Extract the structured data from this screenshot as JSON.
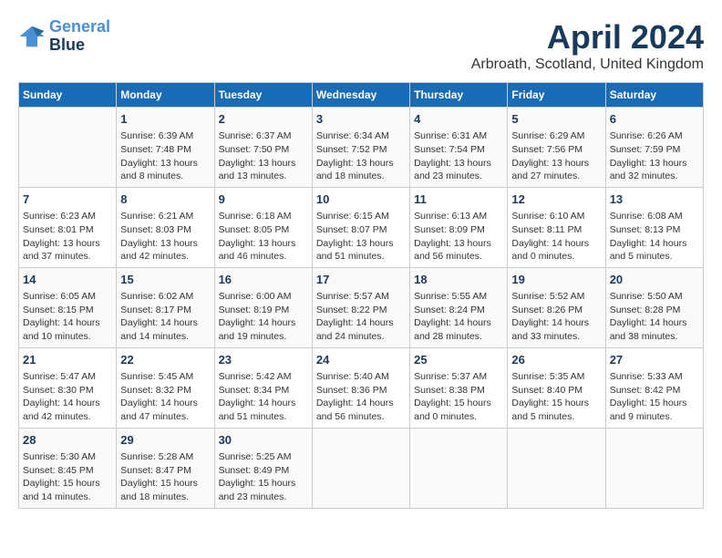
{
  "header": {
    "logo_line1": "General",
    "logo_line2": "Blue",
    "month": "April 2024",
    "location": "Arbroath, Scotland, United Kingdom"
  },
  "days_of_week": [
    "Sunday",
    "Monday",
    "Tuesday",
    "Wednesday",
    "Thursday",
    "Friday",
    "Saturday"
  ],
  "weeks": [
    [
      {
        "day": "",
        "info": ""
      },
      {
        "day": "1",
        "info": "Sunrise: 6:39 AM\nSunset: 7:48 PM\nDaylight: 13 hours\nand 8 minutes."
      },
      {
        "day": "2",
        "info": "Sunrise: 6:37 AM\nSunset: 7:50 PM\nDaylight: 13 hours\nand 13 minutes."
      },
      {
        "day": "3",
        "info": "Sunrise: 6:34 AM\nSunset: 7:52 PM\nDaylight: 13 hours\nand 18 minutes."
      },
      {
        "day": "4",
        "info": "Sunrise: 6:31 AM\nSunset: 7:54 PM\nDaylight: 13 hours\nand 23 minutes."
      },
      {
        "day": "5",
        "info": "Sunrise: 6:29 AM\nSunset: 7:56 PM\nDaylight: 13 hours\nand 27 minutes."
      },
      {
        "day": "6",
        "info": "Sunrise: 6:26 AM\nSunset: 7:59 PM\nDaylight: 13 hours\nand 32 minutes."
      }
    ],
    [
      {
        "day": "7",
        "info": "Sunrise: 6:23 AM\nSunset: 8:01 PM\nDaylight: 13 hours\nand 37 minutes."
      },
      {
        "day": "8",
        "info": "Sunrise: 6:21 AM\nSunset: 8:03 PM\nDaylight: 13 hours\nand 42 minutes."
      },
      {
        "day": "9",
        "info": "Sunrise: 6:18 AM\nSunset: 8:05 PM\nDaylight: 13 hours\nand 46 minutes."
      },
      {
        "day": "10",
        "info": "Sunrise: 6:15 AM\nSunset: 8:07 PM\nDaylight: 13 hours\nand 51 minutes."
      },
      {
        "day": "11",
        "info": "Sunrise: 6:13 AM\nSunset: 8:09 PM\nDaylight: 13 hours\nand 56 minutes."
      },
      {
        "day": "12",
        "info": "Sunrise: 6:10 AM\nSunset: 8:11 PM\nDaylight: 14 hours\nand 0 minutes."
      },
      {
        "day": "13",
        "info": "Sunrise: 6:08 AM\nSunset: 8:13 PM\nDaylight: 14 hours\nand 5 minutes."
      }
    ],
    [
      {
        "day": "14",
        "info": "Sunrise: 6:05 AM\nSunset: 8:15 PM\nDaylight: 14 hours\nand 10 minutes."
      },
      {
        "day": "15",
        "info": "Sunrise: 6:02 AM\nSunset: 8:17 PM\nDaylight: 14 hours\nand 14 minutes."
      },
      {
        "day": "16",
        "info": "Sunrise: 6:00 AM\nSunset: 8:19 PM\nDaylight: 14 hours\nand 19 minutes."
      },
      {
        "day": "17",
        "info": "Sunrise: 5:57 AM\nSunset: 8:22 PM\nDaylight: 14 hours\nand 24 minutes."
      },
      {
        "day": "18",
        "info": "Sunrise: 5:55 AM\nSunset: 8:24 PM\nDaylight: 14 hours\nand 28 minutes."
      },
      {
        "day": "19",
        "info": "Sunrise: 5:52 AM\nSunset: 8:26 PM\nDaylight: 14 hours\nand 33 minutes."
      },
      {
        "day": "20",
        "info": "Sunrise: 5:50 AM\nSunset: 8:28 PM\nDaylight: 14 hours\nand 38 minutes."
      }
    ],
    [
      {
        "day": "21",
        "info": "Sunrise: 5:47 AM\nSunset: 8:30 PM\nDaylight: 14 hours\nand 42 minutes."
      },
      {
        "day": "22",
        "info": "Sunrise: 5:45 AM\nSunset: 8:32 PM\nDaylight: 14 hours\nand 47 minutes."
      },
      {
        "day": "23",
        "info": "Sunrise: 5:42 AM\nSunset: 8:34 PM\nDaylight: 14 hours\nand 51 minutes."
      },
      {
        "day": "24",
        "info": "Sunrise: 5:40 AM\nSunset: 8:36 PM\nDaylight: 14 hours\nand 56 minutes."
      },
      {
        "day": "25",
        "info": "Sunrise: 5:37 AM\nSunset: 8:38 PM\nDaylight: 15 hours\nand 0 minutes."
      },
      {
        "day": "26",
        "info": "Sunrise: 5:35 AM\nSunset: 8:40 PM\nDaylight: 15 hours\nand 5 minutes."
      },
      {
        "day": "27",
        "info": "Sunrise: 5:33 AM\nSunset: 8:42 PM\nDaylight: 15 hours\nand 9 minutes."
      }
    ],
    [
      {
        "day": "28",
        "info": "Sunrise: 5:30 AM\nSunset: 8:45 PM\nDaylight: 15 hours\nand 14 minutes."
      },
      {
        "day": "29",
        "info": "Sunrise: 5:28 AM\nSunset: 8:47 PM\nDaylight: 15 hours\nand 18 minutes."
      },
      {
        "day": "30",
        "info": "Sunrise: 5:25 AM\nSunset: 8:49 PM\nDaylight: 15 hours\nand 23 minutes."
      },
      {
        "day": "",
        "info": ""
      },
      {
        "day": "",
        "info": ""
      },
      {
        "day": "",
        "info": ""
      },
      {
        "day": "",
        "info": ""
      }
    ]
  ]
}
